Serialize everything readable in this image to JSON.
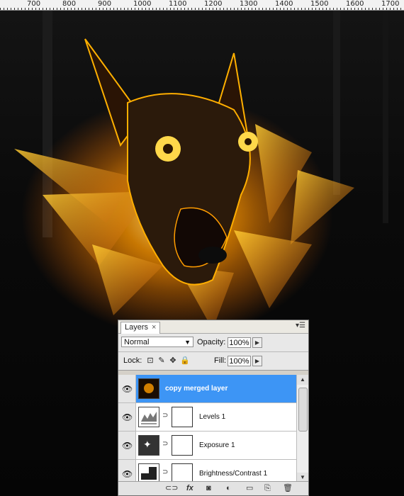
{
  "ruler": {
    "labels": [
      "700",
      "800",
      "900",
      "1000",
      "1100",
      "1200",
      "1300",
      "1400",
      "1500",
      "1600",
      "1700"
    ]
  },
  "panel": {
    "tab_label": "Layers",
    "tab_close": "×",
    "menu_icon": "panel-menu-icon",
    "blend_mode": "Normal",
    "opacity_label": "Opacity:",
    "opacity_value": "100%",
    "lock_label": "Lock:",
    "fill_label": "Fill:",
    "fill_value": "100%",
    "layers": [
      {
        "name": "copy merged layer",
        "selected": true
      },
      {
        "name": "Levels 1",
        "selected": false
      },
      {
        "name": "Exposure 1",
        "selected": false
      },
      {
        "name": "Brightness/Contrast 1",
        "selected": false
      }
    ],
    "footer_fx": "fx"
  }
}
